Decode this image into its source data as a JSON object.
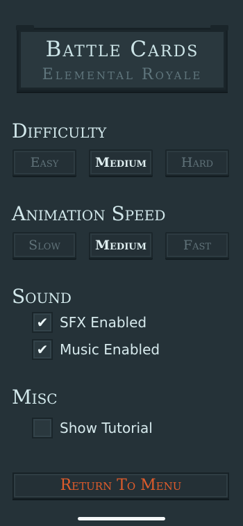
{
  "title": {
    "main": "Battle Cards",
    "subtitle": "Elemental Royale"
  },
  "difficulty": {
    "heading": "Difficulty",
    "options": [
      "Easy",
      "Medium",
      "Hard"
    ],
    "selected": "Medium"
  },
  "animation_speed": {
    "heading": "Animation Speed",
    "options": [
      "Slow",
      "Medium",
      "Fast"
    ],
    "selected": "Medium"
  },
  "sound": {
    "heading": "Sound",
    "sfx": {
      "label": "SFX Enabled",
      "checked": true,
      "check_glyph": "✔"
    },
    "music": {
      "label": "Music Enabled",
      "checked": true,
      "check_glyph": "✔"
    }
  },
  "misc": {
    "heading": "Misc",
    "tutorial": {
      "label": "Show Tutorial",
      "checked": false,
      "check_glyph": ""
    }
  },
  "return_button": "Return To Menu",
  "colors": {
    "background": "#253238",
    "accent": "#e05c2b",
    "text": "#d2e8eb",
    "muted": "#607279"
  }
}
